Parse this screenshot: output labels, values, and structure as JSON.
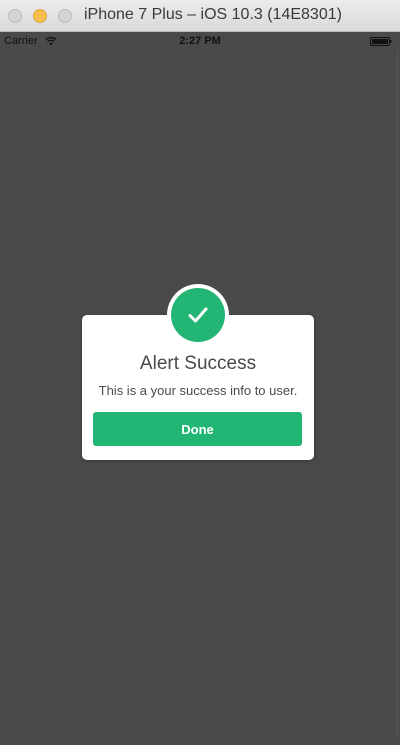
{
  "window": {
    "title": "iPhone 7 Plus – iOS 10.3 (14E8301)"
  },
  "statusbar": {
    "carrier": "Carrier",
    "time": "2:27 PM",
    "icons": [
      "wifi-icon",
      "battery-icon"
    ]
  },
  "alert": {
    "icon": "checkmark-icon",
    "title": "Alert Success",
    "message": "This is a your success info to user.",
    "button_label": "Done"
  },
  "colors": {
    "accent": "#22b573",
    "overlay": "#4a4a4a",
    "text": "#4a4a4a"
  }
}
